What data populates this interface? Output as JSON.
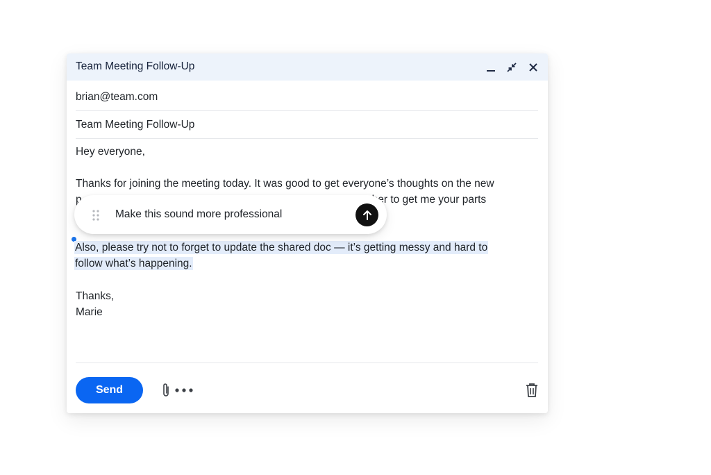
{
  "window": {
    "title": "Team Meeting Follow-Up",
    "controls": [
      "minimize-icon",
      "collapse-icon",
      "close-icon"
    ]
  },
  "to_field": {
    "value": "brian@team.com"
  },
  "subject_field": {
    "value": "Team Meeting Follow-Up"
  },
  "body": {
    "greeting": "Hey everyone,",
    "para1_line1": "Thanks for joining the meeting today. It was good to get everyone’s thoughts on the new",
    "para1_line2_start": "p",
    "para1_line2_end": "nber to get me your parts",
    "para2_line1": "Also, please try not to forget to update the shared doc — it’s getting messy and hard to",
    "para2_line2": "follow what’s happening.",
    "signoff": "Thanks,",
    "signature": "Marie"
  },
  "ai_prompt": {
    "text": "Make this sound more professional",
    "icons": [
      "drag-handle-icon",
      "arrow-up-icon"
    ]
  },
  "footer": {
    "send_label": "Send",
    "icons": [
      "paperclip-icon",
      "more-options-icon",
      "trash-icon"
    ]
  },
  "colors": {
    "titlebar_bg": "#edf3fb",
    "send_button": "#0a66f2",
    "selection_highlight": "#e3ecfa",
    "caret": "#1a73e8",
    "submit_button": "#111111"
  }
}
